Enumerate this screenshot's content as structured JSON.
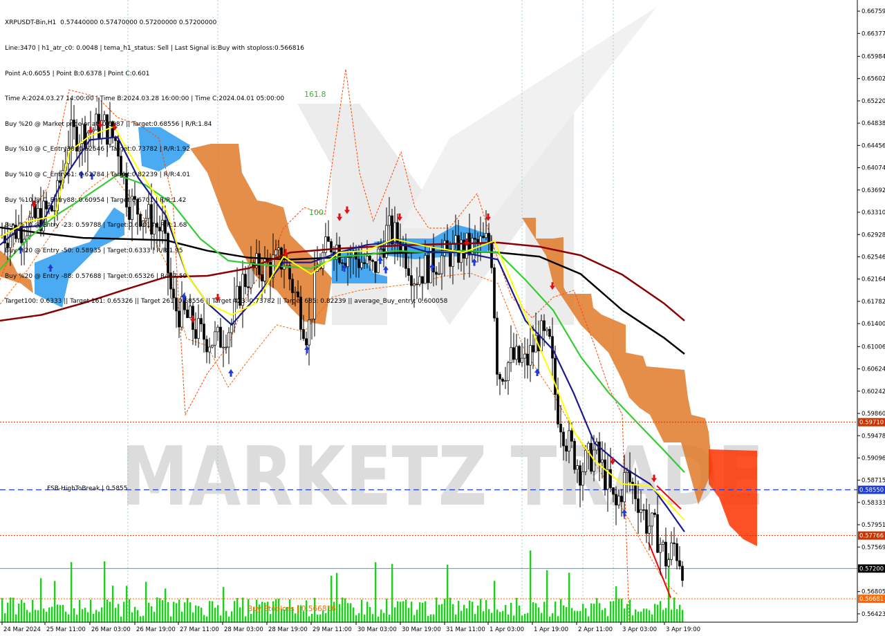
{
  "info_lines": [
    "XRPUSDT-Bin,H1  0.57440000 0.57470000 0.57200000 0.57200000",
    "Line:3470 | h1_atr_c0: 0.0048 | tema_h1_status: Sell | Last Signal is:Buy with stoploss:0.566816",
    "Point A:0.6055 | Point B:0.6378 | Point C:0.601",
    "Time A:2024.03.27 14:00:00 | Time B:2024.03.28 16:00:00 | Time C:2024.04.01 05:00:00",
    "Buy %20 @ Market price or at: 0.6087 || Target:0.68556 | R/R:1.84",
    "Buy %10 @ C_Entry38: 0.62546 | Target:0.73782 | R/R:1.92",
    "Buy %10 @ C_Entry61: 0.61784 | Target:0.82239 | R/R:4.01",
    "Buy %10 @ C_Entry88: 0.60954 | Target:0.6701 | R/R:1.42",
    "Buy %10 @ Entry -23: 0.59788 | Target:0.65014 | R/R:1.68",
    "Buy %20 @ Entry -50: 0.58935 | Target:0.6333 | R/R:1.95",
    "Buy %20 @ Entry -88: 0.57688 | Target:0.65326 | R/R:7.59",
    "Target100: 0.6333 || Target 161: 0.65326 || Target 261: 0.68556 || Target 423: 0.73782 || Target 685: 0.82239 || average_Buy_entry: 0.600058"
  ],
  "price_axis": {
    "ticks": [
      "0.66759",
      "0.66377",
      "0.65984",
      "0.65602",
      "0.65220",
      "0.64838",
      "0.64456",
      "0.64074",
      "0.63692",
      "0.63310",
      "0.62928",
      "0.62546",
      "0.62164",
      "0.61782",
      "0.61400",
      "0.61006",
      "0.60624",
      "0.60242",
      "0.59860",
      "0.59478",
      "0.59096",
      "0.58715",
      "0.58333",
      "0.57951",
      "0.57569",
      "0.56805",
      "0.56423"
    ],
    "markers": [
      {
        "label": "0.59710",
        "value": 0.5971,
        "color": "#cc3300"
      },
      {
        "label": "0.58550",
        "value": 0.5855,
        "color": "#1f3bd6"
      },
      {
        "label": "0.57766",
        "value": 0.57766,
        "color": "#cc3300"
      },
      {
        "label": "0.57200",
        "value": 0.572,
        "color": "#000000"
      },
      {
        "label": "0.56681",
        "value": 0.56681,
        "color": "#ff6600"
      }
    ]
  },
  "time_axis": [
    "24 Mar 2024",
    "25 Mar 11:00",
    "26 Mar 03:00",
    "26 Mar 19:00",
    "27 Mar 11:00",
    "28 Mar 03:00",
    "28 Mar 19:00",
    "29 Mar 11:00",
    "30 Mar 03:00",
    "30 Mar 19:00",
    "31 Mar 11:00",
    "1 Apr 03:00",
    "1 Apr 19:00",
    "2 Apr 11:00",
    "3 Apr 03:00",
    "3 Apr 19:00"
  ],
  "annotations": {
    "fsb_label": "FSB-HighToBreak | 0.5855",
    "stoploss_label": "Buy Stoploss | 0.566816",
    "fib_161": "161.8",
    "fib_100": "100"
  },
  "watermark": "MARKETZ TRADE",
  "colors": {
    "cloud_orange": "#e07a2a",
    "cloud_blue": "#2b9cf0",
    "ema_black": "#000000",
    "ema_darkred": "#8b0000",
    "ema_green": "#33cc33",
    "ema_navy": "#1a1a8c",
    "ema_yellow": "#ffff00",
    "volume_green": "#22cc22",
    "arrow_up": "#1f3bd6",
    "arrow_down": "#e01010"
  },
  "chart_data": {
    "type": "candlestick",
    "symbol": "XRPUSDT-Bin",
    "timeframe": "H1",
    "ylim": [
      0.5628,
      0.6695
    ],
    "series": [
      {
        "name": "ema_black",
        "values": [
          [
            0,
            0.6305
          ],
          [
            60,
            0.6295
          ],
          [
            120,
            0.6287
          ],
          [
            180,
            0.6285
          ],
          [
            240,
            0.6283
          ],
          [
            300,
            0.6265
          ],
          [
            360,
            0.6253
          ],
          [
            420,
            0.625
          ],
          [
            480,
            0.6253
          ],
          [
            540,
            0.626
          ],
          [
            600,
            0.6262
          ],
          [
            660,
            0.6265
          ],
          [
            720,
            0.6262
          ],
          [
            780,
            0.6255
          ],
          [
            840,
            0.6225
          ],
          [
            900,
            0.6163
          ],
          [
            960,
            0.6116
          ],
          [
            990,
            0.6088
          ]
        ]
      },
      {
        "name": "ema_darkred",
        "values": [
          [
            0,
            0.6145
          ],
          [
            60,
            0.6155
          ],
          [
            120,
            0.6175
          ],
          [
            180,
            0.6198
          ],
          [
            240,
            0.622
          ],
          [
            300,
            0.6222
          ],
          [
            360,
            0.6235
          ],
          [
            420,
            0.6262
          ],
          [
            480,
            0.6268
          ],
          [
            540,
            0.6272
          ],
          [
            600,
            0.6275
          ],
          [
            660,
            0.6277
          ],
          [
            720,
            0.6279
          ],
          [
            780,
            0.6272
          ],
          [
            840,
            0.6257
          ],
          [
            900,
            0.6224
          ],
          [
            960,
            0.6175
          ],
          [
            990,
            0.6145
          ]
        ]
      },
      {
        "name": "ema_green",
        "values": [
          [
            0,
            0.6233
          ],
          [
            40,
            0.6285
          ],
          [
            80,
            0.6325
          ],
          [
            120,
            0.6355
          ],
          [
            170,
            0.6395
          ],
          [
            210,
            0.6378
          ],
          [
            250,
            0.6345
          ],
          [
            290,
            0.6285
          ],
          [
            330,
            0.6248
          ],
          [
            370,
            0.6242
          ],
          [
            410,
            0.6238
          ],
          [
            450,
            0.6235
          ],
          [
            490,
            0.6255
          ],
          [
            530,
            0.6258
          ],
          [
            570,
            0.6265
          ],
          [
            620,
            0.6262
          ],
          [
            670,
            0.6265
          ],
          [
            720,
            0.6262
          ],
          [
            760,
            0.6215
          ],
          [
            800,
            0.6163
          ],
          [
            840,
            0.6083
          ],
          [
            880,
            0.6022
          ],
          [
            920,
            0.5972
          ],
          [
            960,
            0.5923
          ],
          [
            990,
            0.5885
          ]
        ]
      },
      {
        "name": "ema_navy",
        "values": [
          [
            0,
            0.6275
          ],
          [
            30,
            0.6305
          ],
          [
            60,
            0.6308
          ],
          [
            90,
            0.6385
          ],
          [
            130,
            0.6455
          ],
          [
            170,
            0.646
          ],
          [
            200,
            0.639
          ],
          [
            240,
            0.6325
          ],
          [
            270,
            0.6225
          ],
          [
            300,
            0.6175
          ],
          [
            335,
            0.6138
          ],
          [
            370,
            0.6185
          ],
          [
            410,
            0.6245
          ],
          [
            450,
            0.6245
          ],
          [
            490,
            0.6262
          ],
          [
            530,
            0.6275
          ],
          [
            570,
            0.628
          ],
          [
            620,
            0.6262
          ],
          [
            670,
            0.6262
          ],
          [
            720,
            0.625
          ],
          [
            760,
            0.6145
          ],
          [
            800,
            0.6095
          ],
          [
            830,
            0.602
          ],
          [
            860,
            0.5935
          ],
          [
            900,
            0.5895
          ],
          [
            940,
            0.5865
          ],
          [
            965,
            0.5825
          ],
          [
            990,
            0.5783
          ]
        ]
      },
      {
        "name": "ema_yellow",
        "values": [
          [
            0,
            0.6288
          ],
          [
            40,
            0.6315
          ],
          [
            80,
            0.6325
          ],
          [
            100,
            0.6435
          ],
          [
            130,
            0.6462
          ],
          [
            165,
            0.6478
          ],
          [
            200,
            0.6405
          ],
          [
            240,
            0.6335
          ],
          [
            270,
            0.6225
          ],
          [
            300,
            0.6175
          ],
          [
            335,
            0.6155
          ],
          [
            370,
            0.6175
          ],
          [
            410,
            0.6255
          ],
          [
            450,
            0.6225
          ],
          [
            490,
            0.6262
          ],
          [
            530,
            0.6265
          ],
          [
            570,
            0.6285
          ],
          [
            620,
            0.6272
          ],
          [
            670,
            0.6262
          ],
          [
            715,
            0.6282
          ],
          [
            760,
            0.6155
          ],
          [
            800,
            0.6045
          ],
          [
            830,
            0.5955
          ],
          [
            860,
            0.5905
          ],
          [
            900,
            0.5865
          ],
          [
            940,
            0.5862
          ],
          [
            965,
            0.5835
          ],
          [
            990,
            0.5803
          ]
        ]
      }
    ],
    "signals": {
      "up_arrows": [
        {
          "x": 30,
          "y": 0.6266
        },
        {
          "x": 73,
          "y": 0.6235
        },
        {
          "x": 118,
          "y": 0.6395
        },
        {
          "x": 133,
          "y": 0.6393
        },
        {
          "x": 266,
          "y": 0.6185
        },
        {
          "x": 334,
          "y": 0.6055
        },
        {
          "x": 444,
          "y": 0.6095
        },
        {
          "x": 498,
          "y": 0.6235
        },
        {
          "x": 550,
          "y": 0.6248
        },
        {
          "x": 558,
          "y": 0.6232
        },
        {
          "x": 625,
          "y": 0.6236
        },
        {
          "x": 686,
          "y": 0.6245
        },
        {
          "x": 777,
          "y": 0.6056
        },
        {
          "x": 903,
          "y": 0.5815
        }
      ],
      "down_arrows": [
        {
          "x": 49,
          "y": 0.6345
        },
        {
          "x": 131,
          "y": 0.6472
        },
        {
          "x": 145,
          "y": 0.6482
        },
        {
          "x": 166,
          "y": 0.6478
        },
        {
          "x": 315,
          "y": 0.6185
        },
        {
          "x": 279,
          "y": 0.6148
        },
        {
          "x": 413,
          "y": 0.6262
        },
        {
          "x": 491,
          "y": 0.6323
        },
        {
          "x": 502,
          "y": 0.6335
        },
        {
          "x": 578,
          "y": 0.6323
        },
        {
          "x": 675,
          "y": 0.628
        },
        {
          "x": 706,
          "y": 0.6323
        },
        {
          "x": 799,
          "y": 0.6205
        },
        {
          "x": 886,
          "y": 0.5905
        },
        {
          "x": 946,
          "y": 0.5875
        }
      ]
    }
  }
}
